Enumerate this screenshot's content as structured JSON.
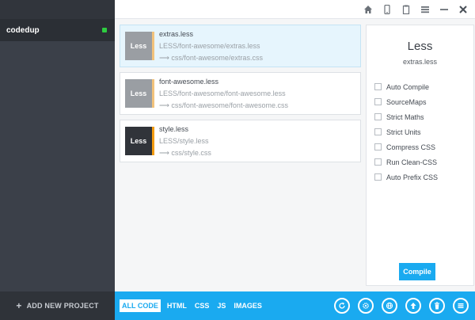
{
  "sidebar": {
    "project_name": "codedup",
    "add_project_label": "ADD NEW PROJECT",
    "add_icon": "plus-icon"
  },
  "topbar": {
    "icons": [
      "home-icon",
      "phone-icon",
      "clipboard-icon",
      "menu-icon",
      "minimize-icon",
      "close-icon"
    ]
  },
  "files": [
    {
      "badge": "Less",
      "name": "extras.less",
      "source": "LESS/font-awesome/extras.less",
      "output": "⟶ css/font-awesome/extras.css",
      "selected": true
    },
    {
      "badge": "Less",
      "name": "font-awesome.less",
      "source": "LESS/font-awesome/font-awesome.less",
      "output": "⟶ css/font-awesome/font-awesome.css",
      "selected": false
    },
    {
      "badge": "Less",
      "name": "style.less",
      "source": "LESS/style.less",
      "output": "⟶ css/style.css",
      "selected": false
    }
  ],
  "panel": {
    "title": "Less",
    "subtitle": "extras.less",
    "options": [
      "Auto Compile",
      "SourceMaps",
      "Strict Maths",
      "Strict Units",
      "Compress CSS",
      "Run Clean-CSS",
      "Auto Prefix CSS"
    ],
    "compile_label": "Compile"
  },
  "bottombar": {
    "filters": [
      "ALL CODE",
      "HTML",
      "CSS",
      "JS",
      "IMAGES"
    ],
    "active_filter": "ALL CODE",
    "actions": [
      "refresh-icon",
      "settings-icon",
      "globe-icon",
      "upload-icon",
      "trash-icon",
      "list-icon"
    ]
  },
  "colors": {
    "accent": "#1aaaf0",
    "sidebar": "#3b4049",
    "status_ok": "#2ecc40",
    "badge_stripe": "#f39c12"
  }
}
